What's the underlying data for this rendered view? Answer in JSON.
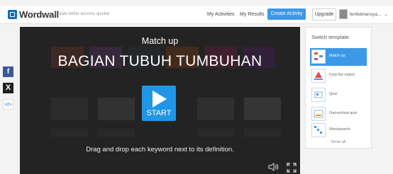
{
  "header": {
    "logo_text": "Wordwall",
    "tagline": "Create better lessons quicker",
    "nav": [
      "My Activities",
      "My Results"
    ],
    "create_label": "Create Activity",
    "upgrade_label": "Upgrade",
    "username": "fenfebriansya..."
  },
  "share": {
    "facebook": "f",
    "x": "X",
    "embed": "</>"
  },
  "player": {
    "activity_type": "Match up",
    "title": "BAGIAN TUBUH TUMBUHAN",
    "start_label": "START",
    "instructions": "Drag and drop each keyword next to its definition."
  },
  "panel": {
    "title": "Switch template",
    "templates": [
      "Match up",
      "Find the match",
      "Quiz",
      "Gameshow quiz",
      "Wordsearch"
    ],
    "show_all": "Show all"
  },
  "colors": {
    "accent": "#3e98e8",
    "start": "#2196e6",
    "player_bg": "#232323"
  }
}
